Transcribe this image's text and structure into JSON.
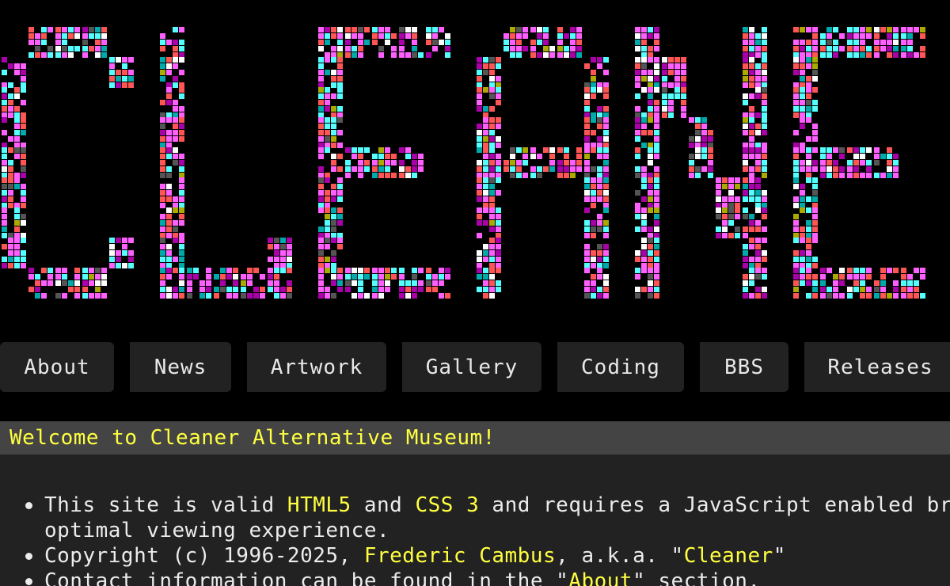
{
  "logo": {
    "text": "CLEANER",
    "colors": [
      "#ff5fff",
      "#55ffff",
      "#ff5555",
      "#ffffff",
      "#aa00aa",
      "#00aaaa",
      "#555555",
      "#aaaa00"
    ]
  },
  "nav": {
    "items": [
      {
        "label": "About"
      },
      {
        "label": "News"
      },
      {
        "label": "Artwork"
      },
      {
        "label": "Gallery"
      },
      {
        "label": "Coding"
      },
      {
        "label": "BBS"
      },
      {
        "label": "Releases"
      }
    ]
  },
  "content": {
    "welcome": "Welcome to Cleaner Alternative Museum!",
    "line1": {
      "pre": "This site is valid ",
      "html5": "HTML5",
      "and": " and ",
      "css": "CSS 3",
      "post": " and requires a JavaScript enabled browser for",
      "cont": "optimal viewing experience."
    },
    "line2": {
      "pre": "Copyright (c) 1996-2025, ",
      "author": "Frederic Cambus",
      "mid": ", a.k.a. \"",
      "alias": "Cleaner",
      "end": "\""
    },
    "line3": {
      "pre": "Contact information can be found in the \"",
      "link": "About",
      "post": "\" section."
    }
  }
}
